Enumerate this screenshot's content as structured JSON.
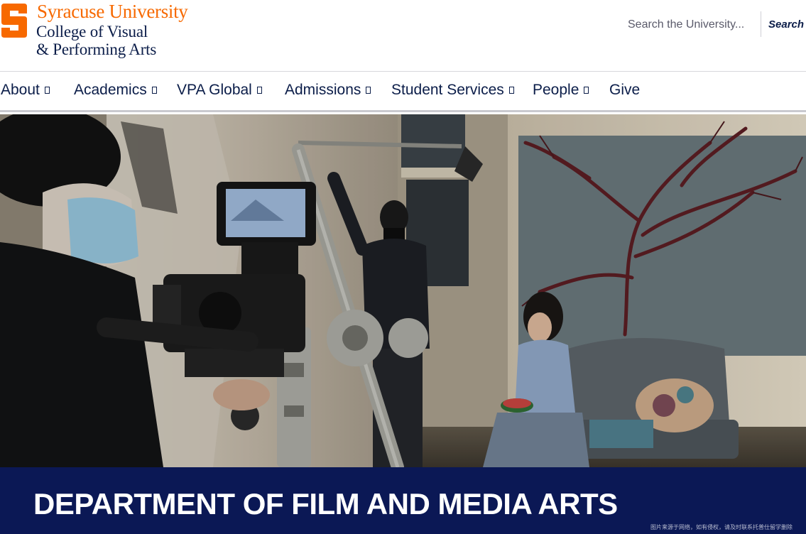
{
  "header": {
    "university_name": "Syracuse University",
    "college_line1": "College of Visual",
    "college_line2": "& Performing Arts",
    "logo_letter": "S",
    "brand_orange": "#f76900",
    "brand_navy": "#0b1d49"
  },
  "search": {
    "placeholder": "Search the University...",
    "button_label": "Search"
  },
  "nav": {
    "items": [
      {
        "label": "About",
        "has_dropdown": true
      },
      {
        "label": "Academics",
        "has_dropdown": true
      },
      {
        "label": "VPA Global",
        "has_dropdown": true
      },
      {
        "label": "Admissions",
        "has_dropdown": true
      },
      {
        "label": "Student Services",
        "has_dropdown": true
      },
      {
        "label": "People",
        "has_dropdown": true
      },
      {
        "label": "Give",
        "has_dropdown": false
      }
    ]
  },
  "hero": {
    "banner_title": "DEPARTMENT OF FILM AND MEDIA ARTS",
    "banner_color": "#0b1855",
    "watermark": "图片来源于网络，如有侵权，请及时联系托普仕留学删除"
  }
}
